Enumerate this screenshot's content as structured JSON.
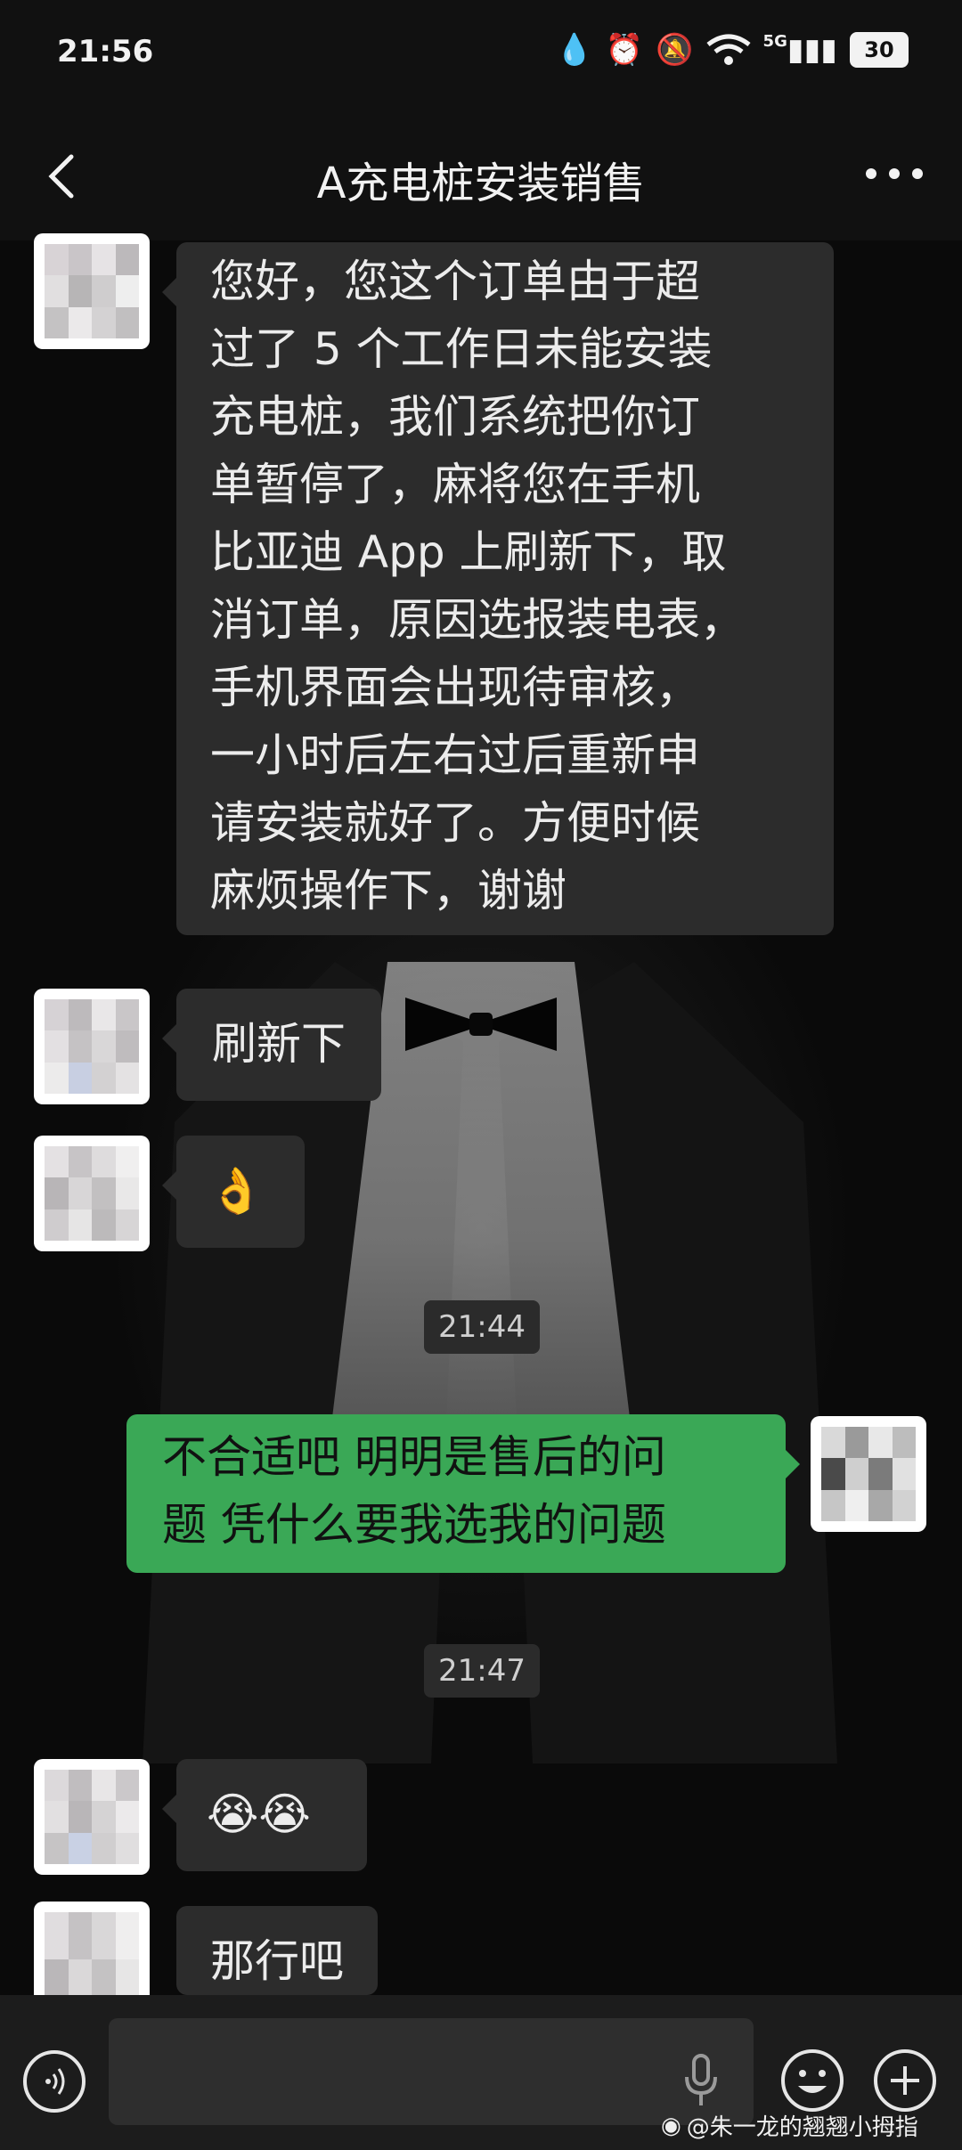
{
  "status": {
    "time": "21:56",
    "network": "5G",
    "battery": "30"
  },
  "header": {
    "title": "A充电桩安装销售"
  },
  "messages": {
    "m1_lines": [
      "您好，您这个订单由于超",
      "过了 5 个工作日未能安装",
      "充电桩，我们系统把你订",
      "单暂停了，麻将您在手机",
      "比亚迪 App 上刷新下，取",
      "消订单，原因选报装电表，",
      "手机界面会出现待审核，",
      "一小时后左右过后重新申",
      "请安装就好了。方便时候",
      "麻烦操作下，谢谢"
    ],
    "m2": "刷新下",
    "m3": "👌",
    "ts1": "21:44",
    "m4_lines": [
      "不合适吧 明明是售后的问",
      "题 凭什么要我选我的问题"
    ],
    "ts2": "21:47",
    "m5": "😭😭",
    "m6": "那行吧"
  },
  "watermark": "@朱一龙的翘翘小拇指",
  "colors": {
    "sent_bubble": "#3aa856",
    "received_bubble": "#2c2c2c",
    "background": "#0b0b0b"
  }
}
